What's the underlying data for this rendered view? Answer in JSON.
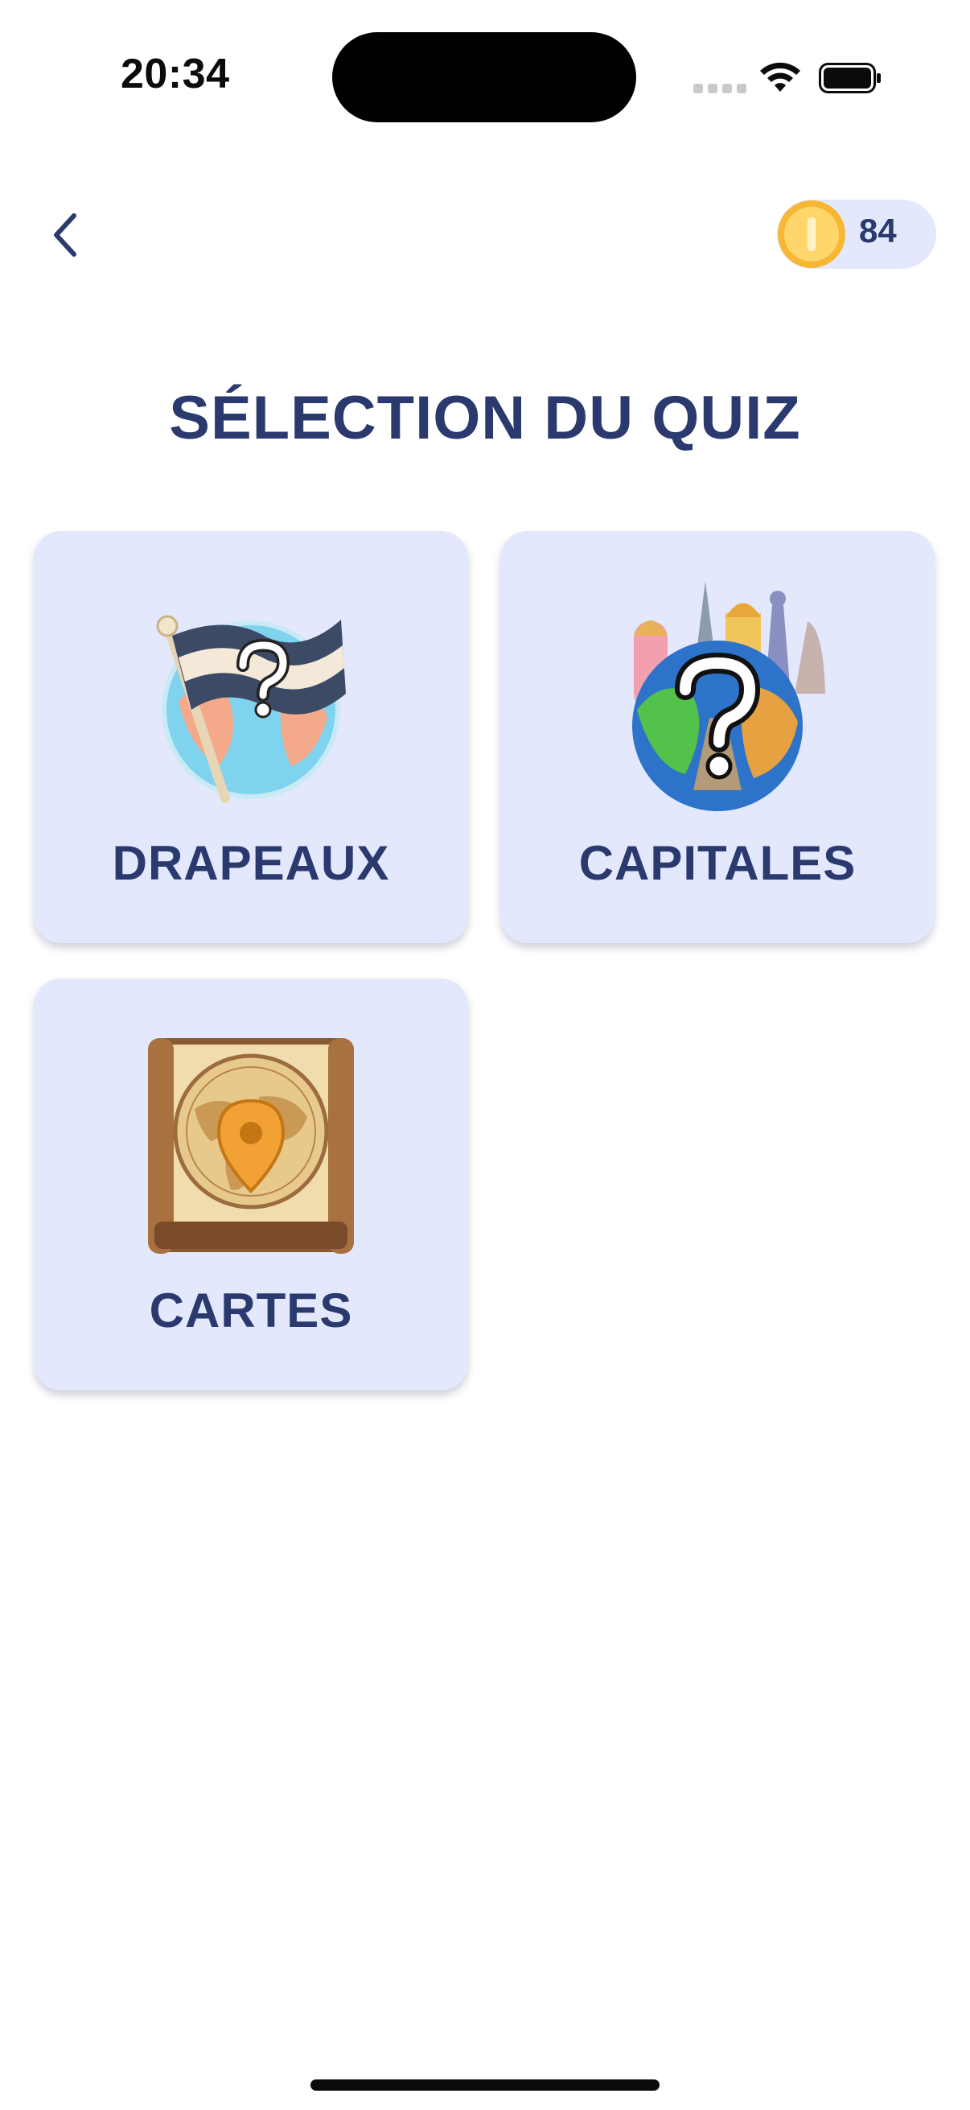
{
  "status_bar": {
    "time": "20:34"
  },
  "header": {
    "back_icon": "chevron-left-icon",
    "coins": {
      "icon": "coin-icon",
      "count": "84"
    }
  },
  "main": {
    "title": "SÉLECTION DU QUIZ",
    "cards": [
      {
        "label": "DRAPEAUX",
        "icon": "flag-question-icon"
      },
      {
        "label": "CAPITALES",
        "icon": "globe-landmarks-question-icon"
      },
      {
        "label": "CARTES",
        "icon": "map-pin-scroll-icon"
      }
    ]
  },
  "colors": {
    "accent_text": "#2b3a6e",
    "card_background": "#e3e8fc",
    "coin": "#ffcc4d"
  }
}
